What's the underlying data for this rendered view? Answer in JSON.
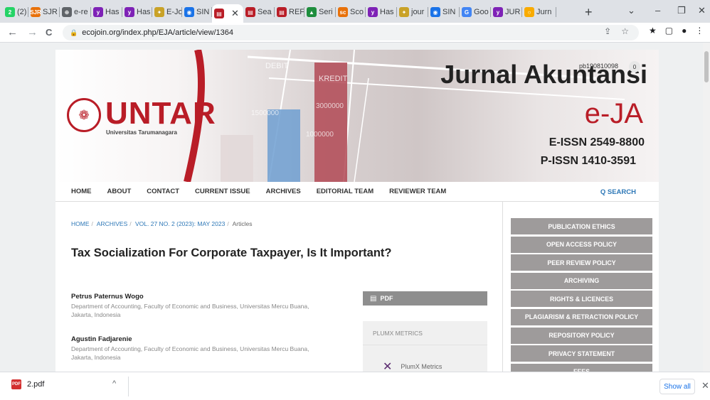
{
  "browser": {
    "tabs": [
      {
        "label": "(2) \\",
        "color": "#25d366",
        "glyph": "2"
      },
      {
        "label": "SJR",
        "color": "#e8710a",
        "glyph": "SJR"
      },
      {
        "label": "e-re",
        "color": "#5f6368",
        "glyph": "⊕"
      },
      {
        "label": "Has",
        "color": "#7e22b6",
        "glyph": "y"
      },
      {
        "label": "Has",
        "color": "#7e22b6",
        "glyph": "y"
      },
      {
        "label": "E-Jo",
        "color": "#c9a227",
        "glyph": "✦"
      },
      {
        "label": "SIN",
        "color": "#1a73e8",
        "glyph": "◉"
      },
      {
        "label": "",
        "color": "#b91d27",
        "glyph": "▤",
        "active": true
      },
      {
        "label": "Sea",
        "color": "#b91d27",
        "glyph": "▤"
      },
      {
        "label": "REF",
        "color": "#b91d27",
        "glyph": "▤"
      },
      {
        "label": "Seri",
        "color": "#1e8e3e",
        "glyph": "▲"
      },
      {
        "label": "Sco",
        "color": "#e8710a",
        "glyph": "sc"
      },
      {
        "label": "Has",
        "color": "#7e22b6",
        "glyph": "y"
      },
      {
        "label": "jour",
        "color": "#c9a227",
        "glyph": "✦"
      },
      {
        "label": "SIN",
        "color": "#1a73e8",
        "glyph": "◉"
      },
      {
        "label": "Goo",
        "color": "#4285f4",
        "glyph": "G"
      },
      {
        "label": "JUR",
        "color": "#7e22b6",
        "glyph": "y"
      },
      {
        "label": "Jurn",
        "color": "#f9ab00",
        "glyph": "○"
      }
    ],
    "new_tab": "+",
    "window_controls": {
      "chevron": "⌄",
      "minimize": "–",
      "restore": "❐",
      "close": "✕"
    },
    "url": "ecojoin.org/index.php/EJA/article/view/1364",
    "icons": {
      "back": "←",
      "forward": "→",
      "reload": "C",
      "lock": "🔒",
      "share": "⇪",
      "star": "☆"
    },
    "ext_icons": [
      "★",
      "▢",
      "●",
      "⋮"
    ]
  },
  "site": {
    "logo_name": "UNTAR",
    "logo_sub": "Universitas Tarumanagara",
    "journal_title": "Jurnal Akuntansi",
    "journal_abbr": "e-JA",
    "eissn": "E-ISSN 2549-8800",
    "pissn": "P-ISSN 1410-3591",
    "username": "pb190810098",
    "notifications": "0",
    "banner_words": [
      "DEBIT",
      "KREDIT",
      "1500000",
      "3000000",
      "1000000"
    ],
    "nav": [
      "HOME",
      "ABOUT",
      "CONTACT",
      "CURRENT ISSUE",
      "ARCHIVES",
      "EDITORIAL TEAM",
      "REVIEWER TEAM"
    ],
    "search": "Q SEARCH"
  },
  "article": {
    "breadcrumb": [
      "HOME",
      "ARCHIVES",
      "VOL. 27 NO. 2 (2023): MAY 2023",
      "Articles"
    ],
    "title": "Tax Socialization For Corporate Taxpayer, Is It Important?",
    "authors": [
      {
        "name": "Petrus Paternus Wogo",
        "affiliation": "Department of Accounting, Faculty of Economic and Business, Universitas Mercu Buana, Jakarta, Indonesia"
      },
      {
        "name": "Agustin Fadjarenie",
        "affiliation": "Department of Accounting, Faculty of Economic and Business, Universitas Mercu Buana, Jakarta, Indonesia"
      }
    ],
    "pdf_label": "PDF",
    "plumx_heading": "PLUMX METRICS",
    "plumx_metric": "PlumX Metrics"
  },
  "sidebar": [
    "PUBLICATION ETHICS",
    "OPEN ACCESS POLICY",
    "PEER REVIEW POLICY",
    "ARCHIVING",
    "RIGHTS & LICENCES",
    "PLAGIARISM & RETRACTION POLICY",
    "REPOSITORY POLICY",
    "PRIVACY STATEMENT",
    "FEES"
  ],
  "downloads": {
    "file": "2.pdf",
    "show_all": "Show all",
    "chevron": "^",
    "close": "✕"
  }
}
